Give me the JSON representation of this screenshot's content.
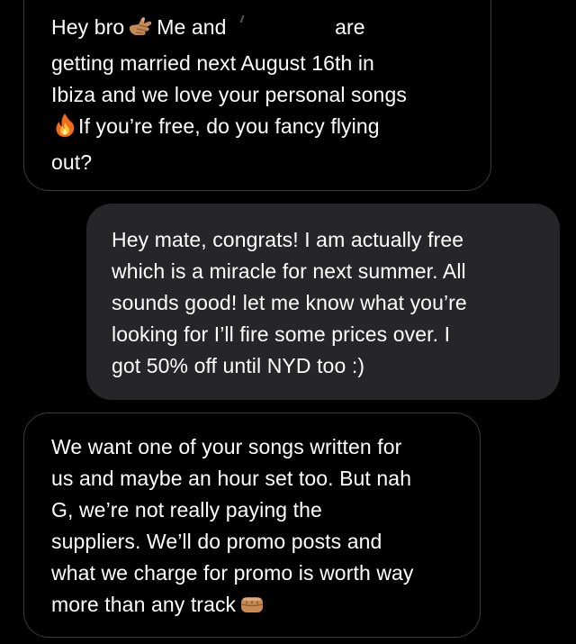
{
  "conversation": {
    "messages": [
      {
        "direction": "incoming",
        "lines": [
          {
            "before": "Hey bro",
            "emoji": "call-me-hand-emoji",
            "middle": "Me and",
            "redacted": true,
            "after": "are"
          },
          "getting married next August 16th in",
          "Ibiza and we love your personal songs",
          {
            "emoji": "fire-emoji",
            "text": "If you’re free, do you fancy flying"
          },
          "out?"
        ]
      },
      {
        "direction": "outgoing",
        "lines": [
          "Hey mate, congrats! I am actually free",
          "which is a miracle for next summer. All",
          "sounds good! let me know what you’re",
          "looking for I’ll fire some prices over. I",
          "got 50% off until NYD too :)"
        ]
      },
      {
        "direction": "incoming",
        "lines": [
          "We want one of your songs written for",
          "us and maybe an hour set too. But nah",
          "G, we’re not really paying the",
          "suppliers. We’ll do promo posts and",
          "what we charge for promo is worth way",
          {
            "text": "more than any track",
            "emoji": "fist-bump-emoji"
          }
        ]
      }
    ]
  },
  "colors": {
    "background": "#000000",
    "incoming_border": "#3a3a3c",
    "outgoing_fill": "#262628",
    "text": "#ffffff"
  }
}
